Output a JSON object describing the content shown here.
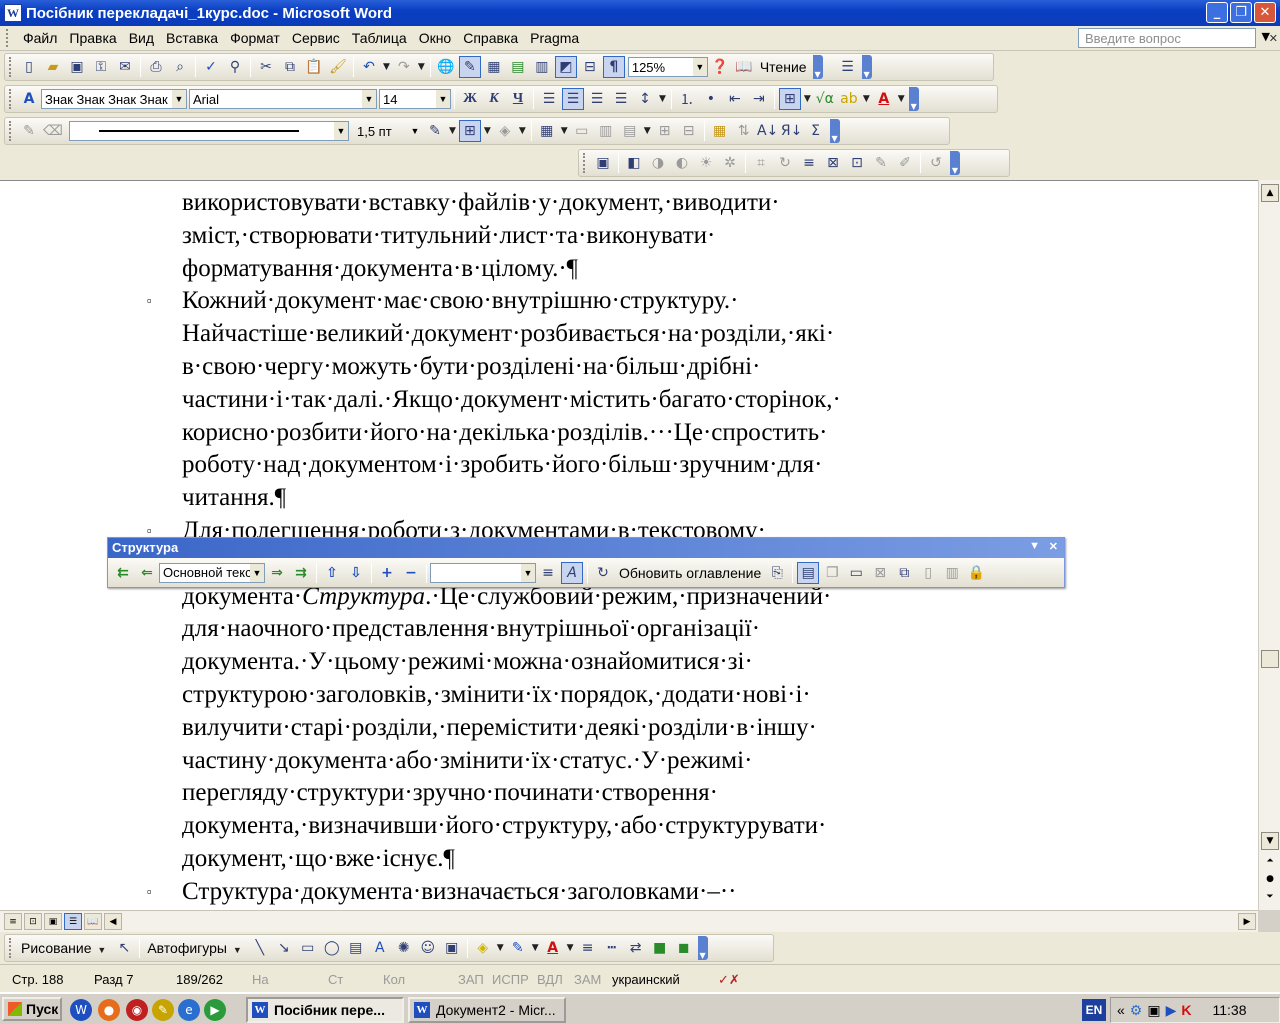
{
  "window": {
    "title": "Посібник перекладачі_1курс.doc - Microsoft Word",
    "app_icon": "W",
    "min_icon": "_",
    "restore_icon": "❐",
    "close_icon": "✕"
  },
  "menu": {
    "items": [
      "Файл",
      "Правка",
      "Вид",
      "Вставка",
      "Формат",
      "Сервис",
      "Таблица",
      "Окно",
      "Справка",
      "Pragma"
    ],
    "ask_placeholder": "Введите вопрос"
  },
  "toolbar_standard": {
    "zoom": "125%",
    "read_label": "Чтение"
  },
  "toolbar_formatting": {
    "style": "Знак Знак Знак Знак",
    "font": "Arial",
    "size": "14",
    "bold": "Ж",
    "italic": "К",
    "underline": "Ч"
  },
  "toolbar_tables": {
    "line_weight": "1,5 пт"
  },
  "document": {
    "lines": [
      "використовувати·вставку·файлів·у·документ,·виводити·",
      "зміст,·створювати·титульний·лист·та·виконувати·",
      "форматування·документа·в·цілому.·¶",
      "Кожний·документ·має·свою·внутрішню·структуру.·",
      "Найчастіше·великий·документ·розбивається·на·розділи,·які·",
      "в·свою·чергу·можуть·бути·розділені·на·більш·дрібні·",
      "частини·і·так·далі.·Якщо·документ·містить·багато·сторінок,·",
      "корисно·розбити·його·на·декілька·розділів.···Це·спростить·",
      "роботу·над·документом·і·зробить·його·більш·зручним·для·",
      "читання.¶",
      "Для·полегшення·роботи·з·документами·в·текстовому·",
      "",
      "документа·Структура.·Це·службовий·режим,·призначений·",
      "для·наочного·представлення·внутрішньої·організації·",
      "документа.·У·цьому·режимі·можна·ознайомитися·зі·",
      "структурою·заголовків,·змінити·їх·порядок,·додати·нові·і·",
      "вилучити·старі·розділи,·перемістити·деякі·розділи·в·іншу·",
      "частину·документа·або·змінити·їх·статус.·У·режимі·",
      "перегляду·структури·зручно·починати·створення·",
      "документа,·визначивши·його·структуру,·або·структурувати·",
      "документ,·що·вже·існує.¶",
      "Структура·документа·визначається·заголовками·–··"
    ],
    "bullet_glyph": "▫"
  },
  "outline_toolbar": {
    "title": "Структура",
    "level": "Основной текст",
    "update_toc": "Обновить оглавление"
  },
  "drawing_toolbar": {
    "draw_label": "Рисование",
    "autoshapes_label": "Автофигуры"
  },
  "status": {
    "page": "Стр. 188",
    "section": "Разд 7",
    "pages": "189/262",
    "at": "На",
    "line": "Ст",
    "col": "Кол",
    "rec": "ЗАП",
    "trk": "ИСПР",
    "ext": "ВДЛ",
    "ovr": "ЗАМ",
    "language": "украинский"
  },
  "taskbar": {
    "start": "Пуск",
    "tasks": [
      "Посібник пере...",
      "Документ2 - Micr..."
    ],
    "lang": "EN",
    "clock": "11:38"
  }
}
